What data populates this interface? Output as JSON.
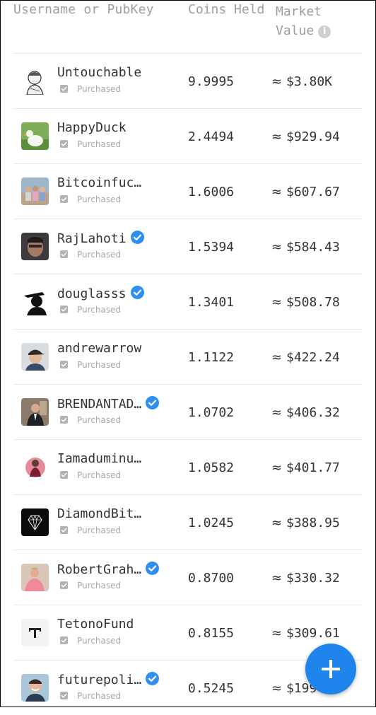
{
  "header": {
    "username_col": "Username or PubKey",
    "coins_col": "Coins Held",
    "market_col_line1": "Market",
    "market_col_line2": "Value",
    "info_icon_glyph": "i"
  },
  "approx_symbol": "≈",
  "purchased_label": "Purchased",
  "colors": {
    "verified_badge": "#2e8ff0",
    "fab": "#1f84ec",
    "header_text": "#9e9e9e"
  },
  "rows": [
    {
      "username": "Untouchable",
      "verified": false,
      "coins": "9.9995",
      "value": "$3.80K",
      "avatar": "sketch-avatar"
    },
    {
      "username": "HappyDuck",
      "verified": false,
      "coins": "2.4494",
      "value": "$929.94",
      "avatar": "duck-avatar"
    },
    {
      "username": "Bitcoinfuc…",
      "verified": false,
      "coins": "1.6006",
      "value": "$607.67",
      "avatar": "group-photo-avatar"
    },
    {
      "username": "RajLahoti",
      "verified": true,
      "coins": "1.5394",
      "value": "$584.43",
      "avatar": "face-photo-avatar"
    },
    {
      "username": "douglasss",
      "verified": true,
      "coins": "1.3401",
      "value": "$508.78",
      "avatar": "silhouette-avatar"
    },
    {
      "username": "andrewarrow",
      "verified": false,
      "coins": "1.1122",
      "value": "$422.24",
      "avatar": "cap-photo-avatar"
    },
    {
      "username": "BRENDANTAD…",
      "verified": true,
      "coins": "1.0702",
      "value": "$406.32",
      "avatar": "suit-photo-avatar"
    },
    {
      "username": "Iamaduminu…",
      "verified": false,
      "coins": "1.0582",
      "value": "$401.77",
      "avatar": "pink-circle-avatar"
    },
    {
      "username": "DiamondBit…",
      "verified": false,
      "coins": "1.0245",
      "value": "$388.95",
      "avatar": "diamond-avatar"
    },
    {
      "username": "RobertGrah…",
      "verified": true,
      "coins": "0.8700",
      "value": "$330.32",
      "avatar": "pink-shirt-avatar"
    },
    {
      "username": "TetonoFund",
      "verified": false,
      "coins": "0.8155",
      "value": "$309.61",
      "avatar": "t-logo-avatar"
    },
    {
      "username": "futurepoli…",
      "verified": true,
      "coins": "0.5245",
      "value": "$199",
      "avatar": "smile-photo-avatar"
    }
  ],
  "fab": {
    "icon": "plus-icon"
  }
}
